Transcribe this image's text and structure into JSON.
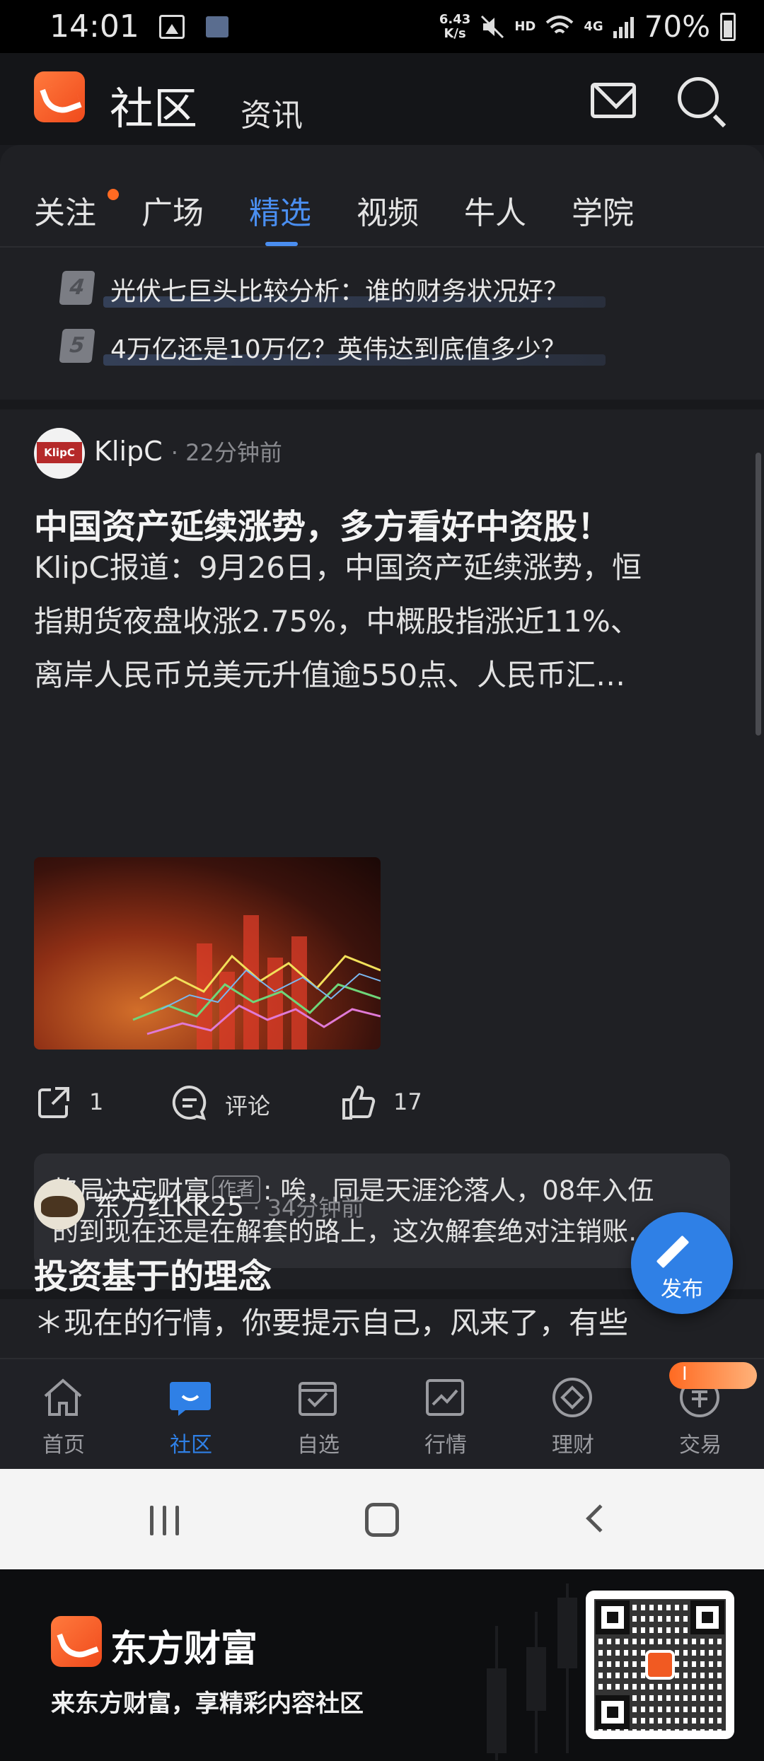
{
  "status_bar": {
    "time": "14:01",
    "net_speed_value": "6.43",
    "net_speed_unit": "K/s",
    "hd": "HD",
    "network": "4G",
    "battery": "70%"
  },
  "header": {
    "title": "社区",
    "subtitle": "资讯"
  },
  "tabs": [
    {
      "label": "关注",
      "has_dot": true
    },
    {
      "label": "广场"
    },
    {
      "label": "精选",
      "active": true
    },
    {
      "label": "视频"
    },
    {
      "label": "牛人"
    },
    {
      "label": "学院"
    }
  ],
  "rankings": [
    {
      "rank": "4",
      "title": "光伏七巨头比较分析：谁的财务状况好？"
    },
    {
      "rank": "5",
      "title": "4万亿还是10万亿？英伟达到底值多少？"
    }
  ],
  "posts": [
    {
      "author": "KlipC",
      "time": "· 22分钟前",
      "title": "中国资产延续涨势，多方看好中资股！",
      "body_lines": [
        "KlipC报道：9月26日，中国资产延续涨势，恒",
        "指期货夜盘收涨2.75%，中概股指涨近11%、",
        "离岸人民币兑美元升值逾550点、人民币汇…"
      ],
      "share_count": "1",
      "comment_label": "评论",
      "like_count": "17",
      "top_comment": {
        "user": "格局决定财富",
        "tag": "作者",
        "line1": ": 唉，同是天涯沦落人，08年入伍",
        "line2": "的到现在还是在解套的路上，这次解套绝对注销账…"
      }
    },
    {
      "author": "东方红KK25",
      "time": "· 34分钟前",
      "title": "投资基于的理念",
      "body_lines": [
        "＊现在的行情，你要提示自己，风来了，有些"
      ]
    }
  ],
  "fab": {
    "label": "发布"
  },
  "bottom_nav": [
    {
      "label": "首页",
      "icon": "home-icon"
    },
    {
      "label": "社区",
      "icon": "community-icon",
      "active": true
    },
    {
      "label": "自选",
      "icon": "watchlist-icon"
    },
    {
      "label": "行情",
      "icon": "market-icon"
    },
    {
      "label": "理财",
      "icon": "finance-icon"
    },
    {
      "label": "交易",
      "icon": "trade-icon"
    }
  ],
  "trade_badge": "I",
  "promo": {
    "brand": "东方财富",
    "slogan": "来东方财富，享精彩内容社区"
  },
  "colors": {
    "accent": "#2f80e6",
    "tab_active": "#4a8ef0",
    "brand_orange": "#f15a22",
    "background": "#1f2024"
  }
}
